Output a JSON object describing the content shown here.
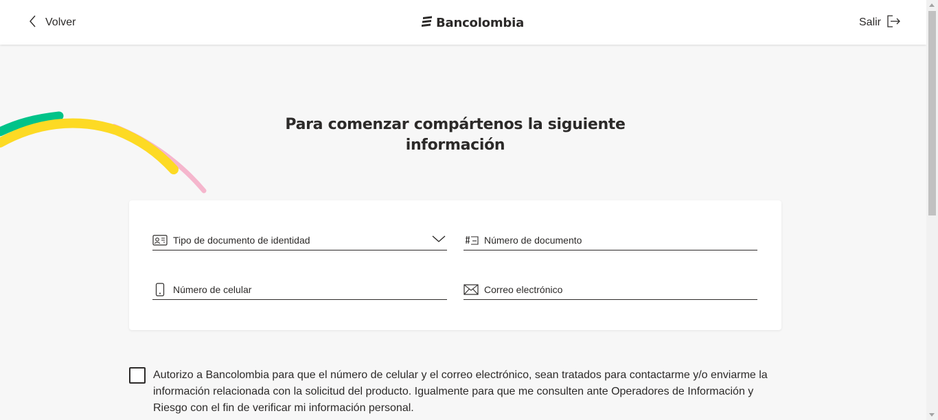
{
  "header": {
    "back_label": "Volver",
    "brand_name": "Bancolombia",
    "exit_label": "Salir"
  },
  "page": {
    "title_line1": "Para comenzar compártenos la siguiente",
    "title_line2": "información"
  },
  "form": {
    "document_type": {
      "placeholder": "Tipo de documento de identidad",
      "icon": "id-card-icon"
    },
    "document_number": {
      "placeholder": "Número de documento",
      "icon": "hash-card-icon"
    },
    "phone": {
      "placeholder": "Número de celular",
      "icon": "mobile-phone-icon"
    },
    "email": {
      "placeholder": "Correo electrónico",
      "icon": "envelope-icon"
    }
  },
  "consent": {
    "checked": false,
    "text": "Autorizo a Bancolombia para que el número de celular y el correo electrónico, sean tratados para contactarme y/o enviarme la información relacionada con la solicitud del producto. Igualmente para que me consulten ante Operadores de Información y Riesgo con el fin de verificar mi información personal."
  },
  "colors": {
    "background": "#f7f7f7",
    "text": "#2c2a29",
    "accent_yellow": "#fdda24",
    "accent_green": "#00c389",
    "accent_pink": "#f5b6cd"
  }
}
